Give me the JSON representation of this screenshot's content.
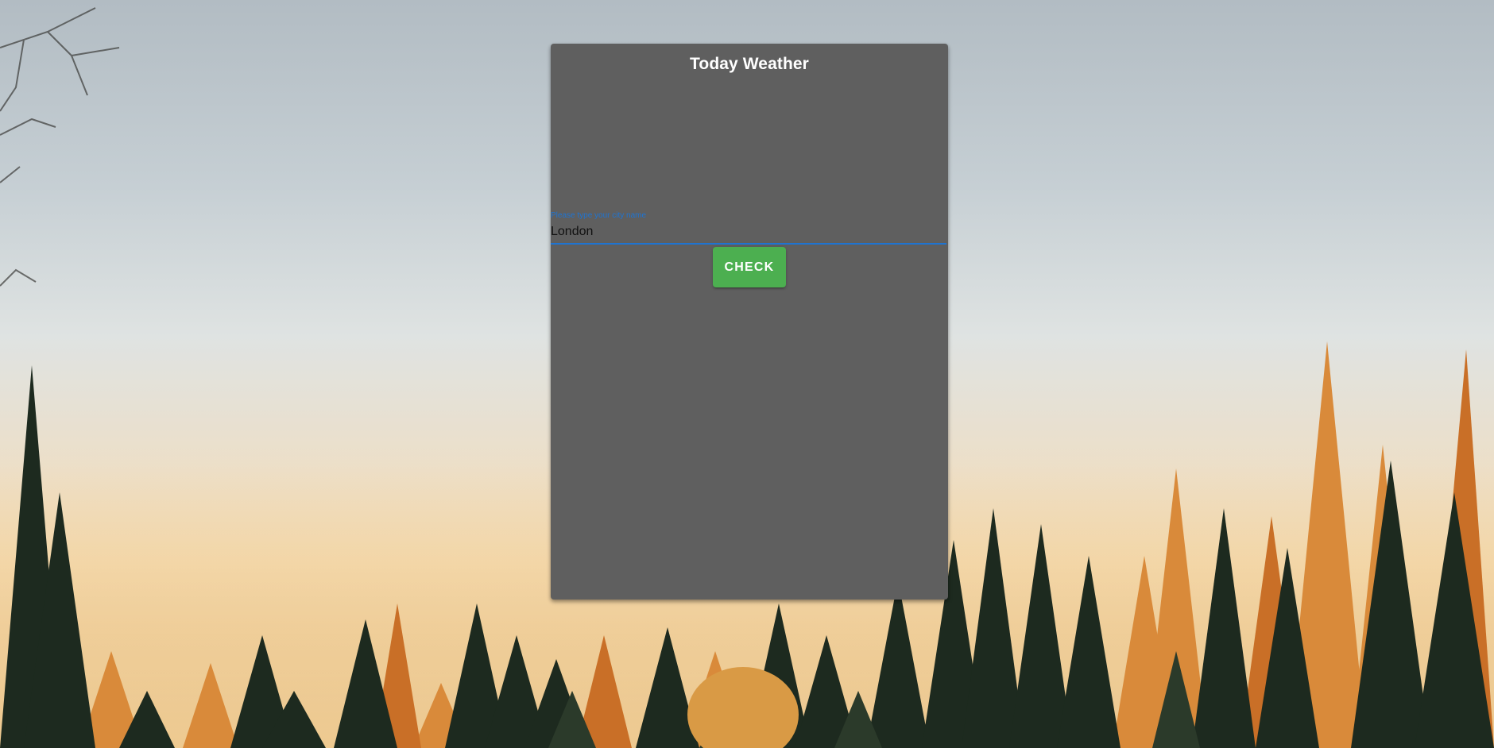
{
  "app": {
    "title": "Today Weather"
  },
  "city_field": {
    "label": "Please type your city name",
    "value": "London"
  },
  "actions": {
    "check_label": "CHECK"
  },
  "colors": {
    "card_background": "#5f5f5f",
    "accent_blue": "#1f74d1",
    "button_green": "#4caf50"
  }
}
